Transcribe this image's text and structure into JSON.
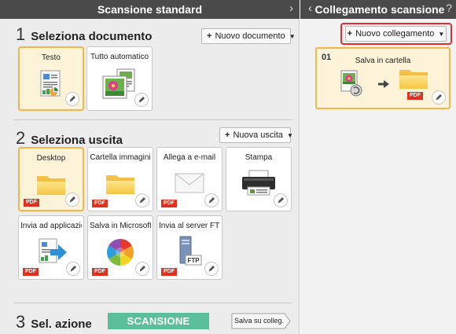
{
  "left_panel": {
    "title": "Scansione standard",
    "collapse_chevron": "›",
    "section1": {
      "number": "1",
      "label": "Seleziona documento",
      "button": "Nuovo documento",
      "button_icon": "plus-icon",
      "tiles": [
        {
          "label": "Testo",
          "icon": "text-document-icon",
          "selected": true
        },
        {
          "label": "Tutto automatico",
          "icon": "mixed-photos-icon",
          "selected": false
        }
      ]
    },
    "section2": {
      "number": "2",
      "label": "Seleziona uscita",
      "button": "Nuova uscita",
      "tiles": [
        {
          "label": "Desktop",
          "icon": "folder-icon",
          "badge": "PDF",
          "selected": true
        },
        {
          "label": "Cartella immagini",
          "icon": "folder-icon",
          "badge": "PDF",
          "selected": false
        },
        {
          "label": "Allega a e-mail",
          "icon": "envelope-icon",
          "badge": "PDF",
          "selected": false
        },
        {
          "label": "Stampa",
          "icon": "printer-icon",
          "selected": false
        },
        {
          "label": "Invia ad applicazio...",
          "icon": "document-arrow-icon",
          "badge": "PDF",
          "selected": false
        },
        {
          "label": "Salva in Microsoft ...",
          "icon": "sharepoint-icon",
          "badge": "PDF",
          "selected": false
        },
        {
          "label": "Invia al server FTP",
          "icon": "ftp-server-icon",
          "badge": "PDF",
          "selected": false
        }
      ]
    },
    "section3": {
      "number": "3",
      "label": "Sel. azione",
      "scan_button": "SCANSIONE",
      "save_button": "Salva su colleg."
    }
  },
  "right_panel": {
    "title": "Collegamento scansione",
    "back_chevron": "‹",
    "help": "?",
    "new_button": "Nuovo collegamento",
    "jobs": [
      {
        "number": "01",
        "label": "Salva in cartella",
        "badge": "PDF",
        "source_icon": "scanner-document-icon",
        "dest_icon": "folder-icon"
      }
    ]
  },
  "colors": {
    "title_bar": "#4a4a4a",
    "selection_border": "#f3b64d",
    "selection_fill": "#fdf3d8",
    "scan_button": "#5bbf9c",
    "pdf_badge": "#e0301e",
    "highlight_box": "#e52b2b"
  }
}
